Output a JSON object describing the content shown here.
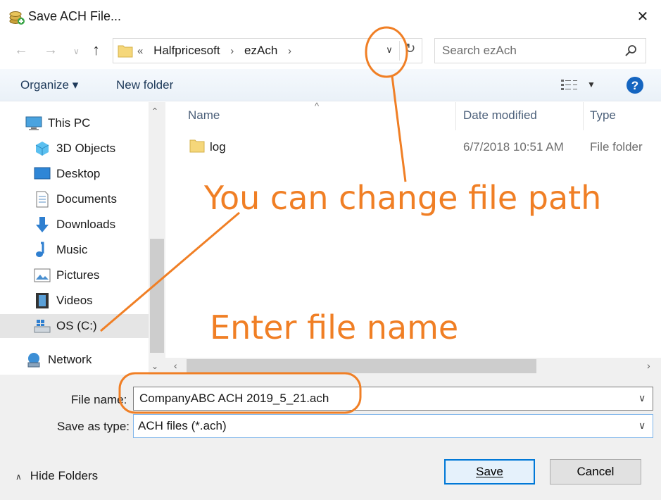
{
  "window": {
    "title": "Save ACH File..."
  },
  "address": {
    "overflow": "«",
    "crumbs": [
      "Halfpricesoft",
      "ezAch"
    ]
  },
  "search": {
    "placeholder": "Search ezAch"
  },
  "toolbar": {
    "organize": "Organize ▾",
    "new_folder": "New folder"
  },
  "sidebar": {
    "items": [
      {
        "label": "This PC"
      },
      {
        "label": "3D Objects"
      },
      {
        "label": "Desktop"
      },
      {
        "label": "Documents"
      },
      {
        "label": "Downloads"
      },
      {
        "label": "Music"
      },
      {
        "label": "Pictures"
      },
      {
        "label": "Videos"
      },
      {
        "label": "OS (C:)"
      },
      {
        "label": "Network"
      }
    ]
  },
  "columns": {
    "name": "Name",
    "date": "Date modified",
    "type": "Type"
  },
  "files": [
    {
      "name": "log",
      "date": "6/7/2018 10:51 AM",
      "type": "File folder"
    }
  ],
  "form": {
    "file_name_label": "File name:",
    "file_name_value": "CompanyABC ACH 2019_5_21.ach",
    "save_type_label": "Save as type:",
    "save_type_value": "ACH files (*.ach)"
  },
  "footer": {
    "hide_folders": "Hide Folders",
    "save": "Save",
    "cancel": "Cancel"
  },
  "annotations": {
    "path_note": "You can change file path",
    "name_note": "Enter file name",
    "color": "#f07f25"
  }
}
